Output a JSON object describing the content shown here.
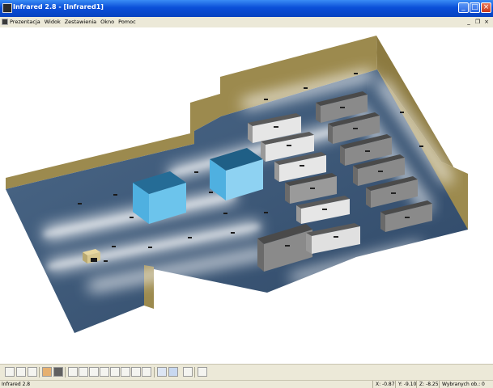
{
  "window": {
    "title": "Infrared 2.8 - [Infrared1]",
    "minimize_glyph": "_",
    "maximize_glyph": "□",
    "close_glyph": "×"
  },
  "menu": {
    "items": [
      {
        "label": "Prezentacja"
      },
      {
        "label": "Widok"
      },
      {
        "label": "Zestawienia"
      },
      {
        "label": "Okno"
      },
      {
        "label": "Pomoc"
      }
    ],
    "mdi_minimize": "_",
    "mdi_restore": "❐",
    "mdi_close": "×"
  },
  "viewport": {
    "scene": "3D warehouse infrared lighting visualization",
    "colors": {
      "wall": "#9c8a4e",
      "floor": "#3f5a78",
      "light_band": "#ffffff",
      "cold_room": "#3a9fd8",
      "rack_dark": "#7a7a7a",
      "rack_light": "#d8d8d8"
    }
  },
  "toolbar": {
    "buttons": [
      "pencil-icon",
      "save-icon",
      "print-icon",
      "materials-icon",
      "render-icon",
      "view-front-icon",
      "view-back-icon",
      "view-left-icon",
      "view-right-icon",
      "view-top-icon",
      "view-bottom-icon",
      "view-iso-icon",
      "view-persp-icon",
      "lamps-icon",
      "calculate-icon",
      "window-icon",
      "export-icon"
    ]
  },
  "status": {
    "app_label": "Infrared 2.8",
    "x": "X: -0.87",
    "y": "Y: -9.10",
    "z": "Z: -8.25",
    "selected": "Wybranych ob.: 0"
  }
}
